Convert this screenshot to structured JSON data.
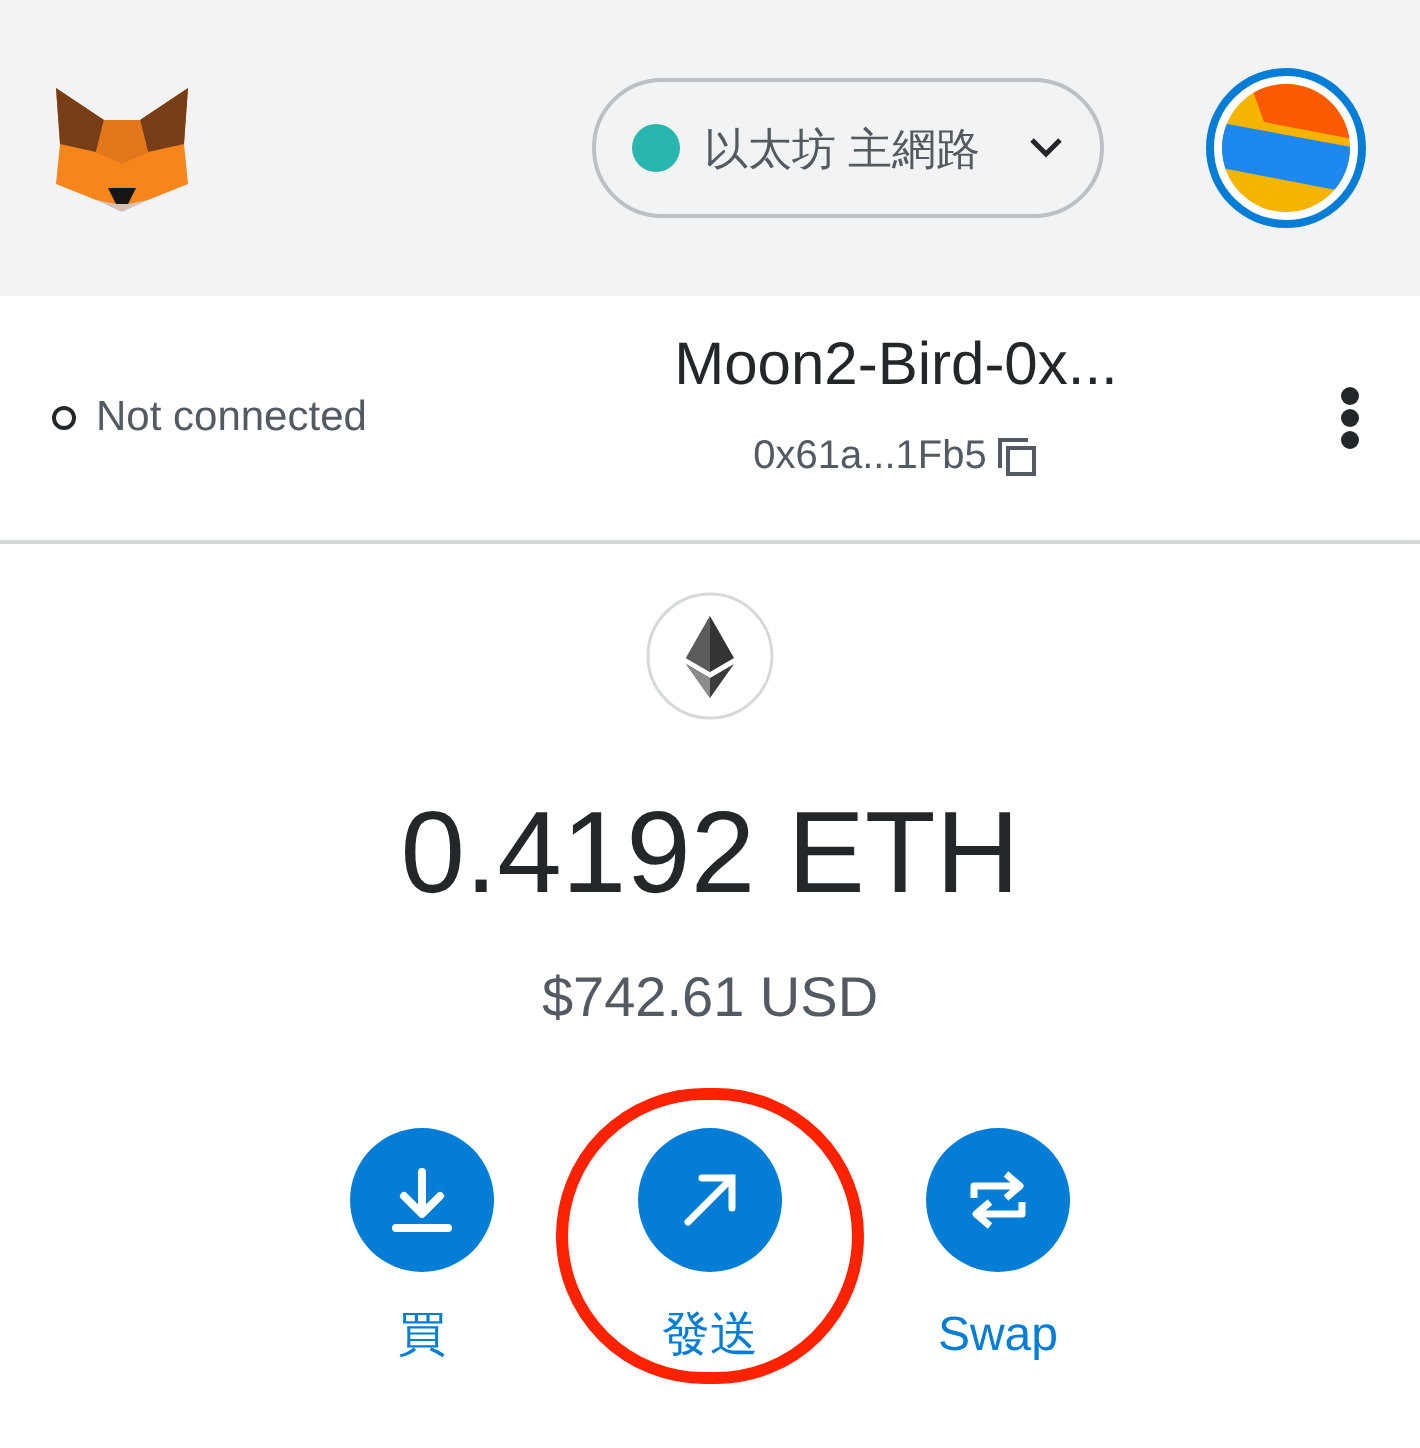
{
  "header": {
    "network": {
      "label": "以太坊 主網路",
      "color": "#29b6af"
    }
  },
  "account": {
    "connected": false,
    "connection_label": "Not connected",
    "name": "Moon2-Bird-0x...",
    "address": "0x61a...1Fb5"
  },
  "balance": {
    "amount": "0.4192 ETH",
    "fiat": "$742.61 USD"
  },
  "actions": [
    {
      "kind": "buy",
      "label": "買",
      "highlighted": false
    },
    {
      "kind": "send",
      "label": "發送",
      "highlighted": true
    },
    {
      "kind": "swap",
      "label": "Swap",
      "highlighted": false
    }
  ]
}
